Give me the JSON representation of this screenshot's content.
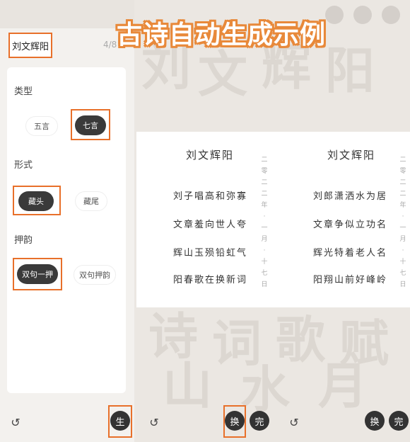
{
  "banner": {
    "title": "古诗自动生成示例"
  },
  "left": {
    "name": "刘文辉阳",
    "counter": "4/8",
    "sections": {
      "type_label": "类型",
      "form_label": "形式",
      "rhyme_label": "押韵"
    },
    "type_options": [
      "五言",
      "七言"
    ],
    "form_options": [
      "藏头",
      "藏尾"
    ],
    "rhyme_options": [
      "双句一押",
      "双句押韵"
    ],
    "selected": {
      "type": "七言",
      "form": "藏头",
      "rhyme": "双句一押"
    },
    "undo_icon": "undo-icon",
    "generate_label": "生"
  },
  "poems": [
    {
      "title": "刘文辉阳",
      "lines": [
        "刘子唱高和弥寡",
        "文章羞向世人夸",
        "辉山玉殒铅虹气",
        "阳春歌在换新词"
      ],
      "date": "二零二二年·一月·十七日"
    },
    {
      "title": "刘文辉阳",
      "lines": [
        "刘郎潇洒水为居",
        "文章争似立功名",
        "辉光特着老人名",
        "阳翔山前好峰岭"
      ],
      "date": "二零二二年·一月·十七日"
    }
  ],
  "bottom": {
    "undo_icon": "undo-icon",
    "swap_label": "换",
    "done_label": "完"
  },
  "colors": {
    "highlight": "#e8702a",
    "selected_bg": "#3a3a3a",
    "banner_stroke": "#e8893a"
  }
}
